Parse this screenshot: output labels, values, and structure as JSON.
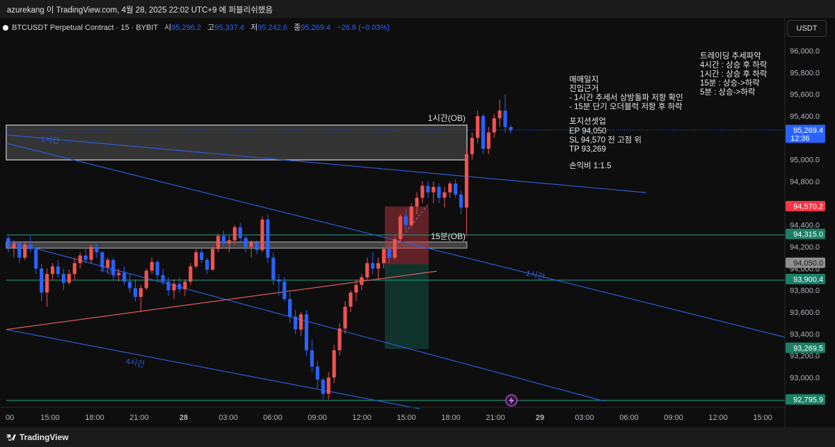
{
  "header": {
    "caption": "azurekang 이 TradingView.com, 4월 28, 2025 22:02 UTC+9 에 퍼블리쉬했음",
    "symbol": "BTCUSDT Perpetual Contract · 15 · BYBIT",
    "ohlc": [
      {
        "label": "시",
        "value": "95,296.2"
      },
      {
        "label": "고",
        "value": "95,337.4"
      },
      {
        "label": "저",
        "value": "95,242.6"
      },
      {
        "label": "종",
        "value": "95,269.4"
      }
    ],
    "change": "−26.8 (−0.03%)",
    "currency": "USDT"
  },
  "footer": {
    "brand": "TradingView"
  },
  "colors": {
    "up": "#ef5350",
    "down": "#2962ff",
    "trendline": "#2e5bd6",
    "support_line": "#1f8a70",
    "ob_box": "#9e9e9e",
    "red_trend": "#e05a5a"
  },
  "chart_data": {
    "type": "candlestick",
    "y_axis": {
      "min": 92700,
      "max": 96100,
      "ticks": [
        "96,000.0",
        "95,800.0",
        "95,600.0",
        "95,400.0",
        "95,200.0",
        "95,000.0",
        "94,800.0",
        "94,600.0",
        "94,400.0",
        "94,200.0",
        "94,000.0",
        "93,800.0",
        "93,600.0",
        "93,400.0",
        "93,200.0",
        "93,000.0"
      ]
    },
    "x_axis": {
      "ticks": [
        "00",
        "15:00",
        "18:00",
        "21:00",
        "28",
        "03:00",
        "06:00",
        "09:00",
        "12:00",
        "15:00",
        "18:00",
        "21:00",
        "29",
        "03:00",
        "06:00",
        "09:00",
        "12:00",
        "15:00"
      ]
    },
    "price_labels": [
      {
        "value": "95,269.4",
        "sub": "12:36",
        "kind": "last"
      },
      {
        "value": "94,570.2",
        "kind": "sl"
      },
      {
        "value": "94,315.0",
        "kind": "line"
      },
      {
        "value": "94,050.0",
        "kind": "ep"
      },
      {
        "value": "93,900.4",
        "kind": "line"
      },
      {
        "value": "93,269.5",
        "kind": "tp"
      },
      {
        "value": "92,795.9",
        "kind": "line"
      }
    ],
    "zone_labels": {
      "ob_1h": "1시간(OB)",
      "ob_15m": "15분(OB)",
      "trend_1h_a": "1시간",
      "trend_1h_b": "1시간",
      "trend_4h_a": "4시간",
      "trend_4h_b": "4시간"
    },
    "notes": {
      "trend": [
        "트레이딩 추세파악",
        "4시간 : 상승 후 하락",
        "1시간 : 상승 후 하락",
        "15분 : 상승->하락",
        "5분 : 상승->하락"
      ],
      "reason": [
        "매매일지",
        "진입근거",
        "- 1시간 추세서 상방돌파 저항 확인",
        "- 15분 단기 오더블럭 저항 후 하락"
      ],
      "setup": [
        "포지션셋업",
        "EP 94,050",
        "SL 94,570 전 고점 위",
        "TP 93,269"
      ],
      "rr": "손익비 1:1.5"
    },
    "candles": [
      [
        94280,
        94300,
        94150,
        94190
      ],
      [
        94190,
        94260,
        94100,
        94230
      ],
      [
        94230,
        94240,
        94050,
        94100
      ],
      [
        94100,
        94250,
        94080,
        94220
      ],
      [
        94220,
        94300,
        94150,
        94180
      ],
      [
        94180,
        94200,
        93950,
        94000
      ],
      [
        94000,
        94040,
        93700,
        93780
      ],
      [
        93780,
        94000,
        93650,
        93950
      ],
      [
        93950,
        94050,
        93900,
        94020
      ],
      [
        94020,
        94080,
        93920,
        93950
      ],
      [
        93950,
        94000,
        93800,
        93870
      ],
      [
        93870,
        93990,
        93850,
        93950
      ],
      [
        93950,
        94100,
        93900,
        94050
      ],
      [
        94050,
        94150,
        94000,
        94120
      ],
      [
        94120,
        94180,
        94050,
        94080
      ],
      [
        94080,
        94220,
        94050,
        94200
      ],
      [
        94200,
        94230,
        94100,
        94150
      ],
      [
        94150,
        94160,
        93980,
        94010
      ],
      [
        94010,
        94100,
        93950,
        94080
      ],
      [
        94080,
        94100,
        93900,
        93940
      ],
      [
        93940,
        94000,
        93880,
        93960
      ],
      [
        93960,
        94020,
        93850,
        93880
      ],
      [
        93880,
        93950,
        93780,
        93820
      ],
      [
        93820,
        93900,
        93700,
        93740
      ],
      [
        93740,
        93850,
        93600,
        93820
      ],
      [
        93820,
        94000,
        93800,
        93980
      ],
      [
        93980,
        94100,
        93950,
        94060
      ],
      [
        94060,
        94080,
        93900,
        93940
      ],
      [
        93940,
        94000,
        93850,
        93880
      ],
      [
        93880,
        93920,
        93750,
        93800
      ],
      [
        93800,
        93900,
        93720,
        93860
      ],
      [
        93860,
        93920,
        93780,
        93810
      ],
      [
        93810,
        93900,
        93750,
        93880
      ],
      [
        93880,
        94050,
        93850,
        94020
      ],
      [
        94020,
        94180,
        94000,
        94150
      ],
      [
        94150,
        94200,
        94050,
        94080
      ],
      [
        94080,
        94100,
        93950,
        93990
      ],
      [
        93990,
        94200,
        93980,
        94180
      ],
      [
        94180,
        94320,
        94150,
        94300
      ],
      [
        94300,
        94350,
        94200,
        94230
      ],
      [
        94230,
        94300,
        94150,
        94260
      ],
      [
        94260,
        94400,
        94220,
        94380
      ],
      [
        94380,
        94420,
        94250,
        94280
      ],
      [
        94280,
        94300,
        94150,
        94200
      ],
      [
        94200,
        94260,
        94100,
        94240
      ],
      [
        94240,
        94260,
        94130,
        94170
      ],
      [
        94170,
        94480,
        94150,
        94450
      ],
      [
        94450,
        94500,
        94050,
        94100
      ],
      [
        94100,
        94150,
        93850,
        93900
      ],
      [
        93900,
        93950,
        93750,
        93880
      ],
      [
        93880,
        93920,
        93700,
        93720
      ],
      [
        93720,
        93780,
        93500,
        93560
      ],
      [
        93560,
        93620,
        93400,
        93440
      ],
      [
        93440,
        93600,
        93380,
        93580
      ],
      [
        93580,
        93620,
        93200,
        93250
      ],
      [
        93250,
        93350,
        93050,
        93100
      ],
      [
        93100,
        93150,
        92900,
        92980
      ],
      [
        92980,
        93000,
        92800,
        92850
      ],
      [
        92850,
        93050,
        92800,
        93000
      ],
      [
        93000,
        93300,
        92950,
        93250
      ],
      [
        93250,
        93500,
        93200,
        93450
      ],
      [
        93450,
        93700,
        93400,
        93650
      ],
      [
        93650,
        93800,
        93600,
        93780
      ],
      [
        93780,
        93900,
        93700,
        93850
      ],
      [
        93850,
        93950,
        93800,
        93920
      ],
      [
        93920,
        94100,
        93900,
        94050
      ],
      [
        94050,
        94150,
        93950,
        94000
      ],
      [
        94000,
        94100,
        93900,
        94050
      ],
      [
        94050,
        94200,
        94000,
        94180
      ],
      [
        94180,
        94250,
        94050,
        94100
      ],
      [
        94100,
        94300,
        94080,
        94270
      ],
      [
        94270,
        94500,
        94250,
        94480
      ],
      [
        94480,
        94550,
        94350,
        94400
      ],
      [
        94400,
        94600,
        94380,
        94570
      ],
      [
        94570,
        94700,
        94500,
        94650
      ],
      [
        94650,
        94800,
        94600,
        94760
      ],
      [
        94760,
        94800,
        94650,
        94700
      ],
      [
        94700,
        94800,
        94600,
        94750
      ],
      [
        94750,
        94780,
        94600,
        94650
      ],
      [
        94650,
        94750,
        94560,
        94700
      ],
      [
        94700,
        94800,
        94650,
        94780
      ],
      [
        94780,
        94820,
        94650,
        94680
      ],
      [
        94680,
        94720,
        94500,
        94560
      ],
      [
        94560,
        95100,
        94300,
        95050
      ],
      [
        95050,
        95250,
        95000,
        95200
      ],
      [
        95200,
        95450,
        95150,
        95400
      ],
      [
        95400,
        95420,
        95050,
        95100
      ],
      [
        95100,
        95300,
        95050,
        95250
      ],
      [
        95250,
        95420,
        95200,
        95380
      ],
      [
        95380,
        95550,
        95300,
        95450
      ],
      [
        95450,
        95600,
        95250,
        95300
      ],
      [
        95300,
        95320,
        95240,
        95269
      ]
    ]
  }
}
